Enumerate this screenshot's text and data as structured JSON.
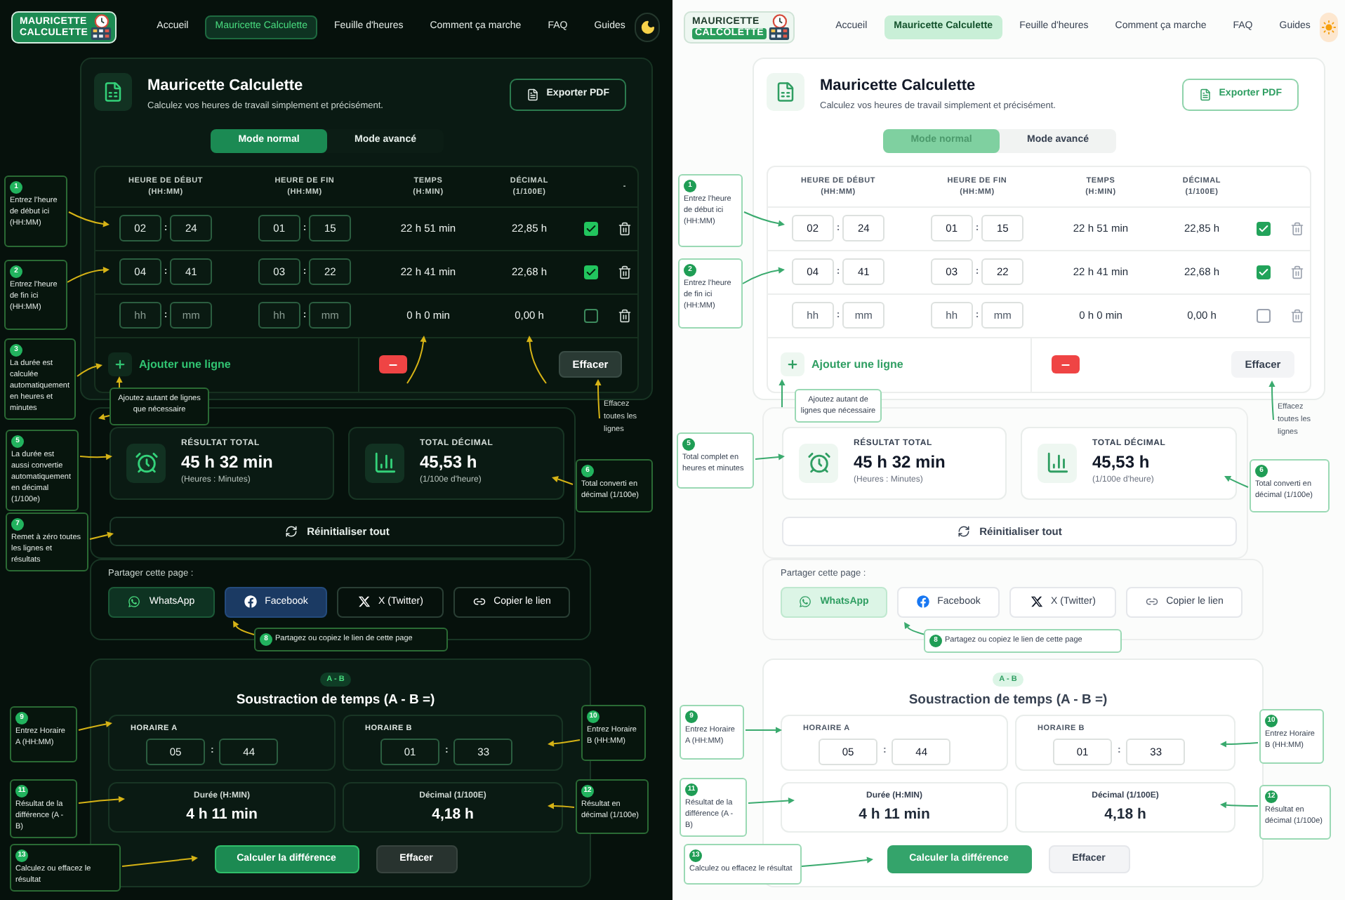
{
  "panels": [
    {
      "kind": "dark",
      "logo": {
        "lines": [
          "MAURICETTE",
          "CALCULETTE"
        ]
      },
      "nav": [
        {
          "label": "Accueil",
          "selected": false
        },
        {
          "label": "Mauricette Calculette",
          "selected": true
        },
        {
          "label": "Feuille d'heures",
          "selected": false
        },
        {
          "label": "Comment ça marche",
          "selected": false
        },
        {
          "label": "FAQ",
          "selected": false
        },
        {
          "label": "Guides",
          "selected": false
        }
      ],
      "calculator": {
        "title": "Mauricette Calculette",
        "subtitle": "Calculez vos heures de travail simplement et précisément.",
        "export_button": "Exporter PDF",
        "modes": [
          {
            "label": "Mode normal",
            "selected": true
          },
          {
            "label": "Mode avancé",
            "selected": false
          }
        ],
        "table": {
          "columns": [
            {
              "label": "HEURE DE DÉBUT",
              "unit": "(HH:MM)"
            },
            {
              "label": "HEURE DE FIN",
              "unit": "(HH:MM)"
            },
            {
              "label": "TEMPS",
              "unit": "(H:MIN)"
            },
            {
              "label": "DÉCIMAL",
              "unit": "(1/100E)"
            },
            {
              "label": "-"
            }
          ],
          "rows": [
            {
              "start": {
                "hours": {
                  "value": "02"
                },
                "separator": ":",
                "minutes": {
                  "value": "24"
                }
              },
              "end": {
                "hours": {
                  "value": "01"
                },
                "separator": ":",
                "minutes": {
                  "value": "15"
                }
              },
              "time": "22 h 51 min",
              "decimal": "22,85 h",
              "checked": true
            },
            {
              "start": {
                "hours": {
                  "value": "04"
                },
                "separator": ":",
                "minutes": {
                  "value": "41"
                }
              },
              "end": {
                "hours": {
                  "value": "03"
                },
                "separator": ":",
                "minutes": {
                  "value": "22"
                }
              },
              "time": "22 h 41 min",
              "decimal": "22,68 h",
              "checked": true
            },
            {
              "start": {
                "hours": {
                  "placeholder": "hh"
                },
                "separator": ":",
                "minutes": {
                  "placeholder": "mm"
                }
              },
              "end": {
                "hours": {
                  "placeholder": "hh"
                },
                "separator": ":",
                "minutes": {
                  "placeholder": "mm"
                }
              },
              "time": "0 h 0 min",
              "decimal": "0,00 h",
              "checked": false
            }
          ]
        },
        "add_row_button": "Ajouter une ligne",
        "clear_button": "Effacer"
      },
      "totals": [
        {
          "kind": "clock",
          "label": "RÉSULTAT TOTAL",
          "value": "45 h 32 min",
          "note": "(Heures : Minutes)"
        },
        {
          "kind": "chart",
          "label": "TOTAL DÉCIMAL",
          "value": "45,53 h",
          "note": "(1/100e d'heure)"
        }
      ],
      "reset_button": "Réinitialiser tout",
      "share": {
        "label": "Partager cette page :",
        "buttons": [
          {
            "kind": "whatsapp",
            "label": "WhatsApp"
          },
          {
            "kind": "facebook",
            "label": "Facebook"
          },
          {
            "kind": "x",
            "label": "X (Twitter)"
          },
          {
            "kind": "link",
            "label": "Copier le lien"
          }
        ]
      },
      "subtraction": {
        "badge": "A - B",
        "title": "Soustraction de temps (A - B =)",
        "inputs": [
          {
            "label": "HORAIRE A",
            "time": {
              "hours": {
                "value": "05"
              },
              "separator": ":",
              "minutes": {
                "value": "44"
              }
            }
          },
          {
            "label": "HORAIRE B",
            "time": {
              "hours": {
                "value": "01"
              },
              "separator": ":",
              "minutes": {
                "value": "33"
              }
            }
          }
        ],
        "results": [
          {
            "label": "Durée (H:MIN)",
            "value": "4 h 11 min"
          },
          {
            "label": "Décimal (1/100E)",
            "value": "4,18 h"
          }
        ],
        "buttons": [
          {
            "kind": "primary",
            "label": "Calculer la différence"
          },
          {
            "kind": "secondary",
            "label": "Effacer"
          }
        ]
      },
      "annotations": [
        {
          "kind": "box",
          "number": "1",
          "text": "Entrez l'heure de début ici (HH:MM)"
        },
        {
          "kind": "box",
          "number": "2",
          "text": "Entrez l'heure de fin ici (HH:MM)"
        },
        {
          "kind": "box",
          "number": "3",
          "text": "La durée est calculée automatiquement en heures et minutes"
        },
        {
          "kind": "box",
          "text": "Ajoutez autant de lignes que nécessaire"
        },
        {
          "kind": "plain",
          "text": "Effacez toutes les lignes"
        },
        {
          "kind": "box",
          "number": "5",
          "text": "La durée est aussi convertie automatiquement en décimal (1/100e)"
        },
        {
          "kind": "box",
          "number": "6",
          "text": "Total converti en décimal (1/100e)"
        },
        {
          "kind": "box",
          "number": "7",
          "text": "Remet à zéro toutes les lignes et résultats"
        },
        {
          "kind": "box",
          "number": "8",
          "text": "Partagez ou copiez le lien de cette page"
        },
        {
          "kind": "box",
          "number": "9",
          "text": "Entrez Horaire A (HH:MM)"
        },
        {
          "kind": "box",
          "number": "10",
          "text": "Entrez Horaire B (HH:MM)"
        },
        {
          "kind": "box",
          "number": "11",
          "text": "Résultat de la différence (A - B)"
        },
        {
          "kind": "box",
          "number": "12",
          "text": "Résultat en décimal (1/100e)"
        },
        {
          "kind": "box",
          "number": "13",
          "text": "Calculez ou effacez le résultat"
        }
      ]
    },
    {
      "kind": "light",
      "logo": {
        "lines": [
          "MAURICETTE",
          "CALCOLETTE"
        ]
      },
      "nav": [
        {
          "label": "Accueil",
          "selected": false
        },
        {
          "label": "Mauricette Calculette",
          "selected": true
        },
        {
          "label": "Feuille d'heures",
          "selected": false
        },
        {
          "label": "Comment ça marche",
          "selected": false
        },
        {
          "label": "FAQ",
          "selected": false
        },
        {
          "label": "Guides",
          "selected": false
        }
      ],
      "calculator": {
        "title": "Mauricette Calculette",
        "subtitle": "Calculez vos heures de travail simplement et précisément.",
        "export_button": "Exporter PDF",
        "modes": [
          {
            "label": "Mode normal",
            "selected": true
          },
          {
            "label": "Mode avancé",
            "selected": false
          }
        ],
        "table": {
          "columns": [
            {
              "label": "HEURE DE DÉBUT",
              "unit": "(HH:MM)"
            },
            {
              "label": "HEURE DE FIN",
              "unit": "(HH:MM)"
            },
            {
              "label": "TEMPS",
              "unit": "(H:MIN)"
            },
            {
              "label": "DÉCIMAL",
              "unit": "(1/100E)"
            }
          ],
          "rows": [
            {
              "start": {
                "hours": {
                  "value": "02"
                },
                "separator": ":",
                "minutes": {
                  "value": "24"
                }
              },
              "end": {
                "hours": {
                  "value": "01"
                },
                "separator": ":",
                "minutes": {
                  "value": "15"
                }
              },
              "time": "22 h 51 min",
              "decimal": "22,85 h",
              "checked": true
            },
            {
              "start": {
                "hours": {
                  "value": "04"
                },
                "separator": ":",
                "minutes": {
                  "value": "41"
                }
              },
              "end": {
                "hours": {
                  "value": "03"
                },
                "separator": ":",
                "minutes": {
                  "value": "22"
                }
              },
              "time": "22 h 41 min",
              "decimal": "22,68 h",
              "checked": true
            },
            {
              "start": {
                "hours": {
                  "placeholder": "hh"
                },
                "separator": ":",
                "minutes": {
                  "placeholder": "mm"
                }
              },
              "end": {
                "hours": {
                  "placeholder": "hh"
                },
                "separator": ":",
                "minutes": {
                  "placeholder": "mm"
                }
              },
              "time": "0 h 0 min",
              "decimal": "0,00 h",
              "checked": false
            }
          ]
        },
        "add_row_button": "Ajouter une ligne",
        "clear_button": "Effacer"
      },
      "totals": [
        {
          "kind": "clock",
          "label": "RÉSULTAT TOTAL",
          "value": "45 h 32 min",
          "note": "(Heures : Minutes)"
        },
        {
          "kind": "chart",
          "label": "TOTAL DÉCIMAL",
          "value": "45,53 h",
          "note": "(1/100e d'heure)"
        }
      ],
      "reset_button": "Réinitialiser tout",
      "share": {
        "label": "Partager cette page :",
        "buttons": [
          {
            "kind": "whatsapp",
            "label": "WhatsApp"
          },
          {
            "kind": "facebook",
            "label": "Facebook"
          },
          {
            "kind": "x",
            "label": "X (Twitter)"
          },
          {
            "kind": "link",
            "label": "Copier le lien"
          }
        ]
      },
      "subtraction": {
        "badge": "A - B",
        "title": "Soustraction de temps (A - B =)",
        "inputs": [
          {
            "label": "HORAIRE A",
            "time": {
              "hours": {
                "value": "05"
              },
              "separator": ":",
              "minutes": {
                "value": "44"
              }
            }
          },
          {
            "label": "HORAIRE B",
            "time": {
              "hours": {
                "value": "01"
              },
              "separator": ":",
              "minutes": {
                "value": "33"
              }
            }
          }
        ],
        "results": [
          {
            "label": "Durée (H:MIN)",
            "value": "4 h 11 min"
          },
          {
            "label": "Décimal (1/100E)",
            "value": "4,18 h"
          }
        ],
        "buttons": [
          {
            "kind": "primary",
            "label": "Calculer la différence"
          },
          {
            "kind": "secondary",
            "label": "Effacer"
          }
        ]
      },
      "annotations": [
        {
          "kind": "box",
          "number": "1",
          "text": "Entrez l'heure de début ici (HH:MM)"
        },
        {
          "kind": "box",
          "number": "2",
          "text": "Entrez l'heure de fin ici (HH:MM)"
        },
        {
          "kind": "box",
          "text": "Ajoutez autant de lignes que nécessaire"
        },
        {
          "kind": "plain",
          "text": "Effacez toutes les lignes"
        },
        {
          "kind": "box",
          "number": "5",
          "text": "Total complet en heures et minutes"
        },
        {
          "kind": "box",
          "number": "6",
          "text": "Total converti en décimal (1/100e)"
        },
        {
          "kind": "box",
          "number": "8",
          "text": "Partagez ou copiez le lien de cette page"
        },
        {
          "kind": "box",
          "number": "9",
          "text": "Entrez Horaire A (HH:MM)"
        },
        {
          "kind": "box",
          "number": "10",
          "text": "Entrez Horaire B (HH:MM)"
        },
        {
          "kind": "box",
          "number": "11",
          "text": "Résultat de la différence (A - B)"
        },
        {
          "kind": "box",
          "number": "12",
          "text": "Résultat en décimal (1/100e)"
        },
        {
          "kind": "box",
          "number": "13",
          "text": "Calculez ou effacez le résultat"
        }
      ]
    }
  ]
}
